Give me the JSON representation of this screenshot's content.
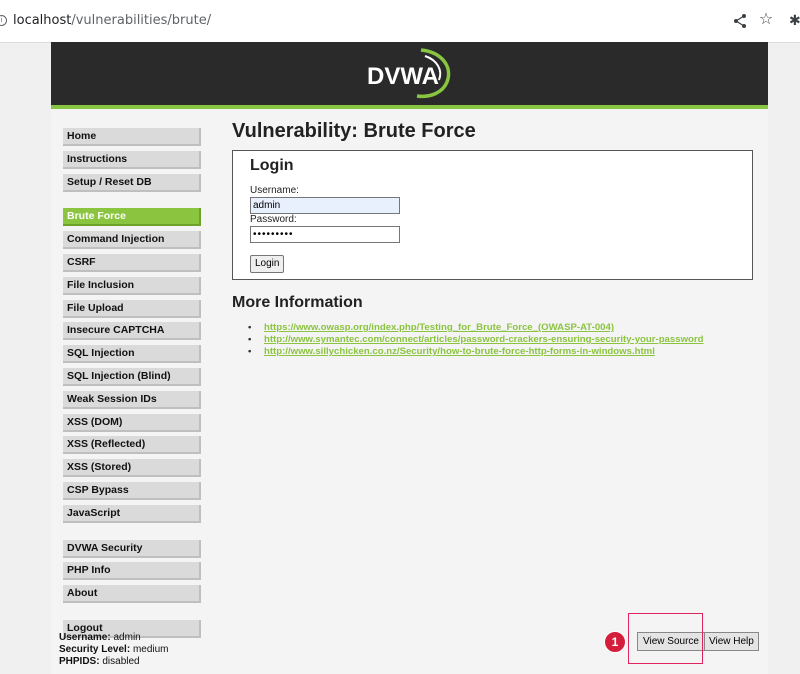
{
  "browser": {
    "url_host": "localhost",
    "url_path": "/vulnerabilities/brute/"
  },
  "header": {
    "logo_text": "DVWA"
  },
  "menu": {
    "group1": [
      "Home",
      "Instructions",
      "Setup / Reset DB"
    ],
    "group2": [
      "Brute Force",
      "Command Injection",
      "CSRF",
      "File Inclusion",
      "File Upload",
      "Insecure CAPTCHA",
      "SQL Injection",
      "SQL Injection (Blind)",
      "Weak Session IDs",
      "XSS (DOM)",
      "XSS (Reflected)",
      "XSS (Stored)",
      "CSP Bypass",
      "JavaScript"
    ],
    "group3": [
      "DVWA Security",
      "PHP Info",
      "About"
    ],
    "group4": [
      "Logout"
    ],
    "selected": "Brute Force"
  },
  "main": {
    "title": "Vulnerability: Brute Force",
    "login": {
      "heading": "Login",
      "username_label": "Username:",
      "username_value": "admin",
      "password_label": "Password:",
      "password_value": "•••••••••",
      "button": "Login"
    },
    "more_info": {
      "heading": "More Information",
      "links": [
        "https://www.owasp.org/index.php/Testing_for_Brute_Force_(OWASP-AT-004)",
        "http://www.symantec.com/connect/articles/password-crackers-ensuring-security-your-password",
        "http://www.sillychicken.co.nz/Security/how-to-brute-force-http-forms-in-windows.html"
      ]
    }
  },
  "footer": {
    "username_label": "Username:",
    "username_value": "admin",
    "security_label": "Security Level:",
    "security_value": "medium",
    "phpids_label": "PHPIDS:",
    "phpids_value": "disabled"
  },
  "buttons": {
    "view_source": "View Source",
    "view_help": "View Help"
  },
  "annotation": {
    "marker": "1",
    "color": "#d41e3c"
  },
  "colors": {
    "accent": "#8bc43f",
    "header_bg": "#2a2a2a"
  }
}
